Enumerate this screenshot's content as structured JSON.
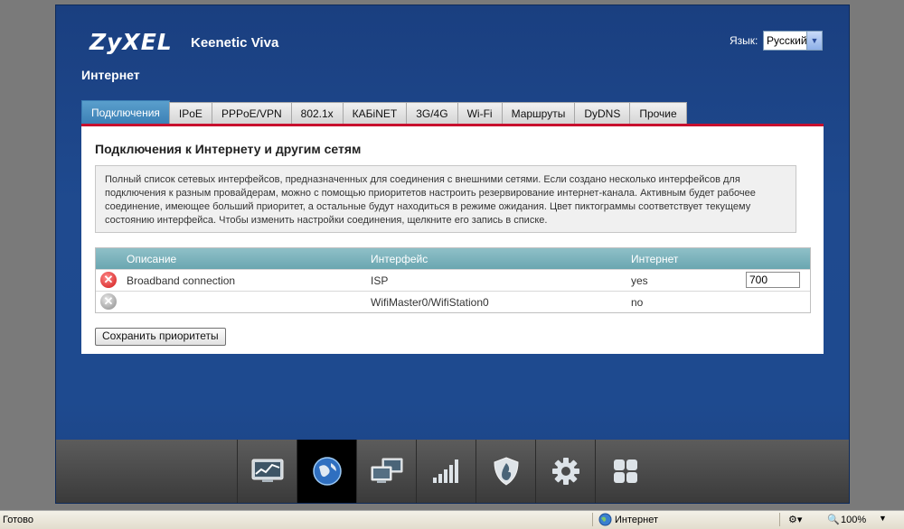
{
  "header": {
    "brand": "ZyXEL",
    "model": "Keenetic Viva",
    "language_label": "Язык:",
    "language_selected": "Русский",
    "page_title": "Интернет"
  },
  "tabs": [
    {
      "label": "Подключения",
      "active": true
    },
    {
      "label": "IPoE"
    },
    {
      "label": "PPPoE/VPN"
    },
    {
      "label": "802.1x"
    },
    {
      "label": "КАБiNET"
    },
    {
      "label": "3G/4G"
    },
    {
      "label": "Wi-Fi"
    },
    {
      "label": "Маршруты"
    },
    {
      "label": "DyDNS"
    },
    {
      "label": "Прочие"
    }
  ],
  "content": {
    "section_title": "Подключения к Интернету и другим сетям",
    "description": "Полный список сетевых интерфейсов, предназначенных для соединения с внешними сетями. Если создано несколько интерфейсов для подключения к разным провайдерам, можно с помощью приоритетов настроить резервирование интернет-канала. Активным будет рабочее соединение, имеющее больший приоритет, а остальные будут находиться в режиме ожидания. Цвет пиктограммы соответствует текущему состоянию интерфейса. Чтобы изменить настройки соединения, щелкните его запись в списке.",
    "table": {
      "headers": {
        "description": "Описание",
        "interface": "Интерфейс",
        "internet": "Интернет"
      },
      "rows": [
        {
          "status": "error",
          "status_color": "#d01818",
          "description": "Broadband connection",
          "interface": "ISP",
          "internet": "yes",
          "priority": "700"
        },
        {
          "status": "disabled",
          "status_color": "#8a8a8a",
          "description": "",
          "interface": "WifiMaster0/WifiStation0",
          "internet": "no",
          "priority": ""
        }
      ]
    },
    "save_button": "Сохранить приоритеты"
  },
  "bottom_nav": [
    {
      "icon": "monitor-chart-icon",
      "active": false
    },
    {
      "icon": "globe-icon",
      "active": true
    },
    {
      "icon": "network-computers-icon",
      "active": false
    },
    {
      "icon": "signal-bars-icon",
      "active": false
    },
    {
      "icon": "shield-icon",
      "active": false
    },
    {
      "icon": "gear-icon",
      "active": false
    },
    {
      "icon": "grid-icon",
      "active": false
    }
  ],
  "status_bar": {
    "text": "Готово",
    "zone": "Интернет",
    "zoom": "100%"
  },
  "colors": {
    "accent": "#c8102e",
    "tab_active": "#3b7fb5",
    "background": "#1d4587",
    "table_header": "#7ab3bc"
  }
}
